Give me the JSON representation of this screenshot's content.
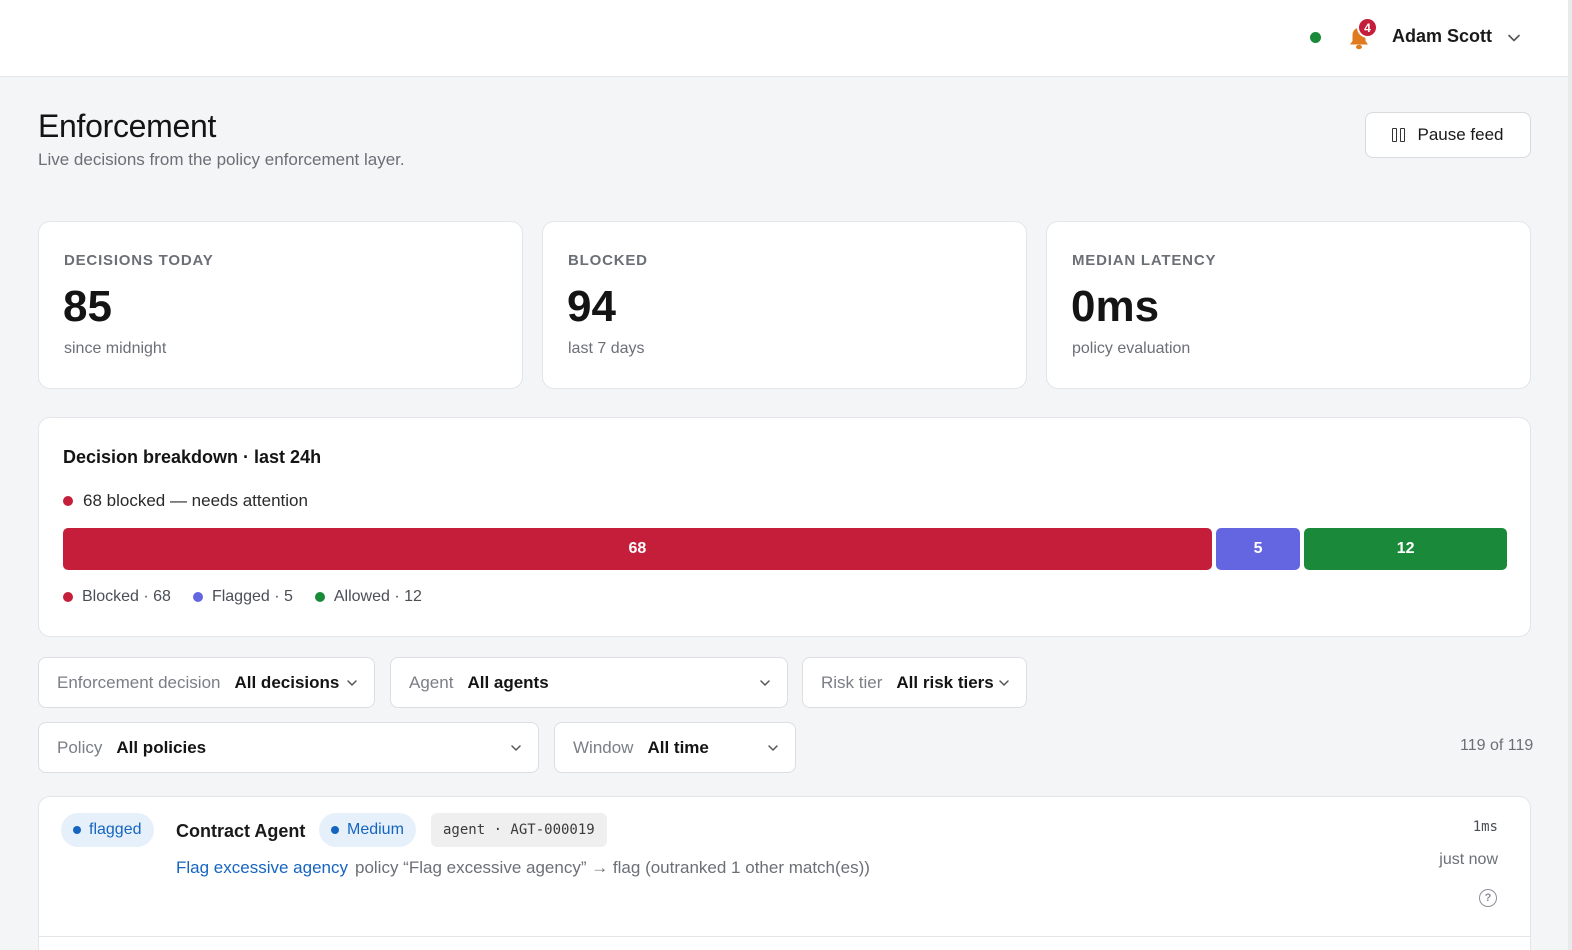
{
  "header": {
    "notification_count": "4",
    "user_name": "Adam Scott",
    "status_color": "#1a8a3a"
  },
  "page": {
    "title": "Enforcement",
    "subtitle": "Live decisions from the policy enforcement layer.",
    "pause_label": "Pause feed"
  },
  "stats": [
    {
      "label": "DECISIONS TODAY",
      "value": "85",
      "sub": "since midnight"
    },
    {
      "label": "BLOCKED",
      "value": "94",
      "sub": "last 7 days"
    },
    {
      "label": "MEDIAN LATENCY",
      "value": "0ms",
      "sub": "policy evaluation"
    }
  ],
  "breakdown": {
    "title": "Decision breakdown · last 24h",
    "alert": "68 blocked — needs attention",
    "segments": [
      {
        "name": "Blocked",
        "value": 68,
        "color": "#c41e3a"
      },
      {
        "name": "Flagged",
        "value": 5,
        "color": "#6366e0"
      },
      {
        "name": "Allowed",
        "value": 12,
        "color": "#1a8a3a"
      }
    ],
    "legend": [
      "Blocked · 68",
      "Flagged · 5",
      "Allowed · 12"
    ]
  },
  "filters": {
    "decision": {
      "label": "Enforcement decision",
      "value": "All decisions"
    },
    "agent": {
      "label": "Agent",
      "value": "All agents"
    },
    "risk": {
      "label": "Risk tier",
      "value": "All risk tiers"
    },
    "policy": {
      "label": "Policy",
      "value": "All policies"
    },
    "window": {
      "label": "Window",
      "value": "All time"
    }
  },
  "result_count": "119 of 119",
  "rows": [
    {
      "decision": "flagged",
      "agent": "Contract Agent",
      "risk": "Medium",
      "agent_id": "agent · AGT-000019",
      "policy": "Flag excessive agency",
      "description": "policy “Flag excessive agency” → flag (outranked 1 other match(es))",
      "latency": "1ms",
      "time": "just now"
    }
  ]
}
